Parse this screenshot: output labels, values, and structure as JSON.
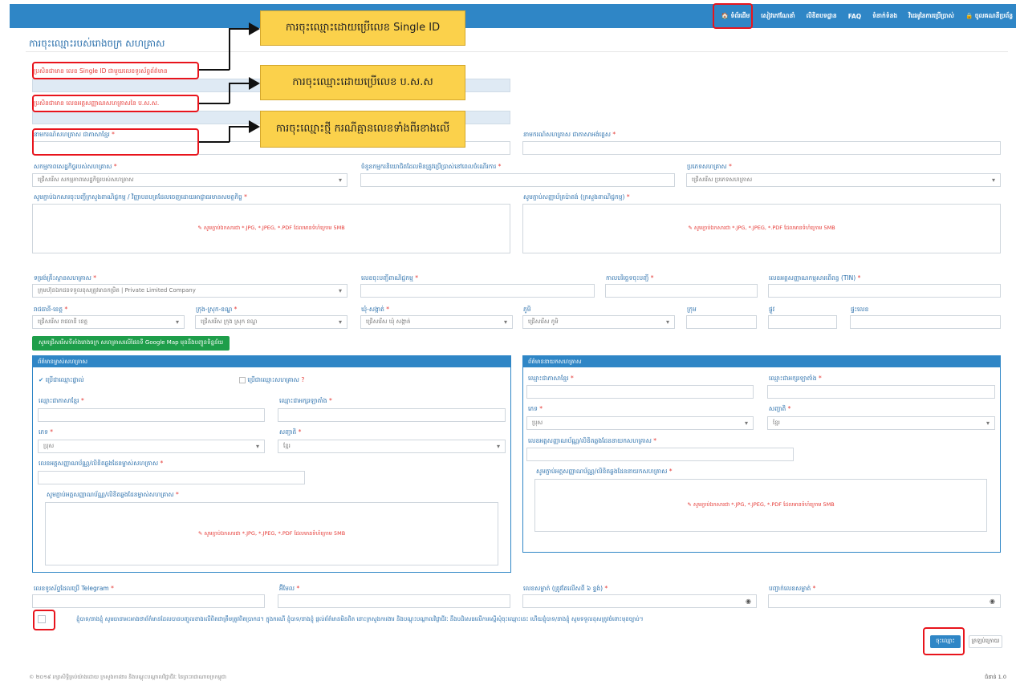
{
  "nav": {
    "items": [
      "🏠 ទំព័រដើម",
      "សៀវភៅណែនាំ",
      "លិខិតបទដ្ឋាន",
      "FAQ",
      "ទំនាក់ទំនង",
      "វិដេអូនៃការប្រើប្រាស់",
      "🔒 ចូលគណនីប្រព័ន្ធ"
    ]
  },
  "page": {
    "title": "ការចុះឈ្មោះរបស់រោងចក្រ សហគ្រាស"
  },
  "callouts": [
    "ការចុះឈ្មោះដោយប្រើលេខ Single ID",
    "ការចុះឈ្មោះដោយប្រើលេខ ប.ស.ស",
    "ការចុះឈ្មោះថ្មី ករណីគ្មានលេខទាំងពីរខាងលើ"
  ],
  "labels": {
    "single_id": "ប្រសិនជាមាន លេខ Single ID ជាមួយលេខទូរស័ព្ទព័ត៌មាន",
    "nssf_id": "ប្រសិនជាមាន លេខអត្តសញ្ញាណសហគ្រាសនៃ ប.ស.ស.",
    "name_kh": "នាមករណ៍សហគ្រាស ជាភាសាខ្មែរ",
    "name_en": "នាមករណ៍សហគ្រាស ជាភាសាអង់គ្លេស",
    "activity": "សកម្មភាពសេដ្ឋកិច្ចរបស់សហគ្រាស",
    "workers": "ចំនួនកម្មករនិយោជិតដែលមិនត្រូវប្រើប្រាស់នៅពេលចំណើរការ",
    "ent_type": "ប្រភេទសហគ្រាស",
    "license_file": "សូមភ្ជាប់ឯកសារចុះបញ្ជីក្រសួងពាណិជ្ជកម្ម / វិញ្ញាបនបត្រដែលចេញដោយអាជ្ញាធរមានសមត្ថកិច្ច",
    "patent_file": "សូមភ្ជាប់សញ្ញាប័ត្រប៉ាតង់ (ក្រសួងពាណិជ្ជកម្ម)",
    "legal_form": "ទម្រង់គ្រឹះស្ថានសហគ្រាស",
    "reg_no": "លេខចុះបញ្ជីពាណិជ្ជកម្ម",
    "reg_date": "កាលបរិច្ឆេទចុះបញ្ជី",
    "tin": "លេខអត្តសញ្ញាណកម្មសារពើពន្ធ (TIN)",
    "province": "រាជធានី-ខេត្ត",
    "district": "ក្រុង-ស្រុក-ខណ្ឌ",
    "commune": "ឃុំ-សង្កាត់",
    "village": "ភូមិ",
    "group": "ក្រុម",
    "street": "ផ្លូវ",
    "house": "ផ្ទះលេខ",
    "telegram": "លេខទូរស័ព្ទដែលប្រើ Telegram",
    "email": "អ៊ីមែល",
    "password": "លេខសម្ងាត់ (ត្រូវតែលើសពី ៦ ខ្ទង់)",
    "confirm_password": "បញ្ជាក់លេខសម្ងាត់"
  },
  "placeholders": {
    "activity": "ជ្រើសរើស សកម្មភាពសេដ្ឋកិច្ចរបស់សហគ្រាស",
    "ent_type": "ជ្រើសរើស ប្រភេទសហគ្រាស",
    "legal_form": "ក្រុមហ៊ុនឯកជនទទួលខុសត្រូវមានកម្រិត | Private Limited Company",
    "province": "ជ្រើសរើស រាជធានី ខេត្ត",
    "district": "ជ្រើសរើស ក្រុង ស្រុក ខណ្ឌ",
    "commune": "ជ្រើសរើស ឃុំ សង្កាត់",
    "village": "ជ្រើសរើស ភូមិ",
    "upload_hint": "✎ សូមភ្ជាប់ឯកសារជា *.JPG, *.JPEG, *.PDF ដែលមានទំហំក្រោម 5MB"
  },
  "map_button": "សូមជ្រើសរើសទីតាំងរោងចក្រ សហគ្រាសលើផែនទី Google Map មុននឹងបញ្ជូនទិន្នន័យ",
  "owner_panel": {
    "title": "ព័ត៌មានម្ចាស់សហគ្រាស",
    "opt_personal": "ប្រើជាឈ្មោះផ្ទាល់",
    "opt_company": "ប្រើជាឈ្មោះសហគ្រាស",
    "name_kh": "ឈ្មោះជាភាសាខ្មែរ",
    "name_latin": "ឈ្មោះជាអក្សរឡាតាំង",
    "sex": "ភេទ",
    "sex_value": "ប្រុស",
    "nationality": "សញ្ជាតិ",
    "nationality_value": "ខ្មែរ",
    "id_no": "លេខអត្តសញ្ញាណប័ណ្ណ/លិខិតឆ្លងដែនម្ចាស់សហគ្រាស",
    "id_file": "សូមភ្ជាប់អត្តសញ្ញាណប័ណ្ណ/លិខិតឆ្លងដែនម្ចាស់សហគ្រាស"
  },
  "director_panel": {
    "title": "ព័ត៌មាននាយកសហគ្រាស",
    "name_kh": "ឈ្មោះជាភាសាខ្មែរ",
    "name_latin": "ឈ្មោះជាអក្សរឡាតាំង",
    "sex": "ភេទ",
    "sex_value": "ប្រុស",
    "nationality": "សញ្ជាតិ",
    "nationality_value": "ខ្មែរ",
    "id_no": "លេខអត្តសញ្ញាណប័ណ្ណ/លិខិតឆ្លងដែននាយកសហគ្រាស",
    "id_file": "សូមភ្ជាប់អត្តសញ្ញាណប័ណ្ណ/លិខិតឆ្លងដែននាយកសហគ្រាស"
  },
  "terms": "ខ្ញុំបាទ/នាងខ្ញុំ សូមធានាអះអាងថាព័ត៌មានដែលបានបញ្ចូលខាងលើពិតជាត្រឹមត្រូវពិតប្រាកដ។ ក្នុងករណី ខ្ញុំបាទ/នាងខ្ញុំ ផ្តល់ព័ត៌មានមិនពិត នោះក្រសួងការងារ និងបណ្តុះបណ្តាលវិជ្ជាជីវៈ នឹងបដិសេធលើការស្នើសុំចុះឈ្មោះនេះ ហើយខ្ញុំបាទ/នាងខ្ញុំ សូមទទួលខុសត្រូវចំពោះមុខច្បាប់។",
  "buttons": {
    "register": "ចុះឈ្មោះ",
    "back": "ត្រឡប់ក្រោយ"
  },
  "footer": {
    "copyright": "© ២០១៩ រក្សាសិទ្ធិគ្រប់យ៉ាងដោយ ក្រសួងការងារ និងបណ្តុះបណ្តាលវិជ្ជាជីវៈ នៃព្រះរាជាណាចក្រកម្ពុជា",
    "version": "ជំនាន់ 1.0"
  }
}
